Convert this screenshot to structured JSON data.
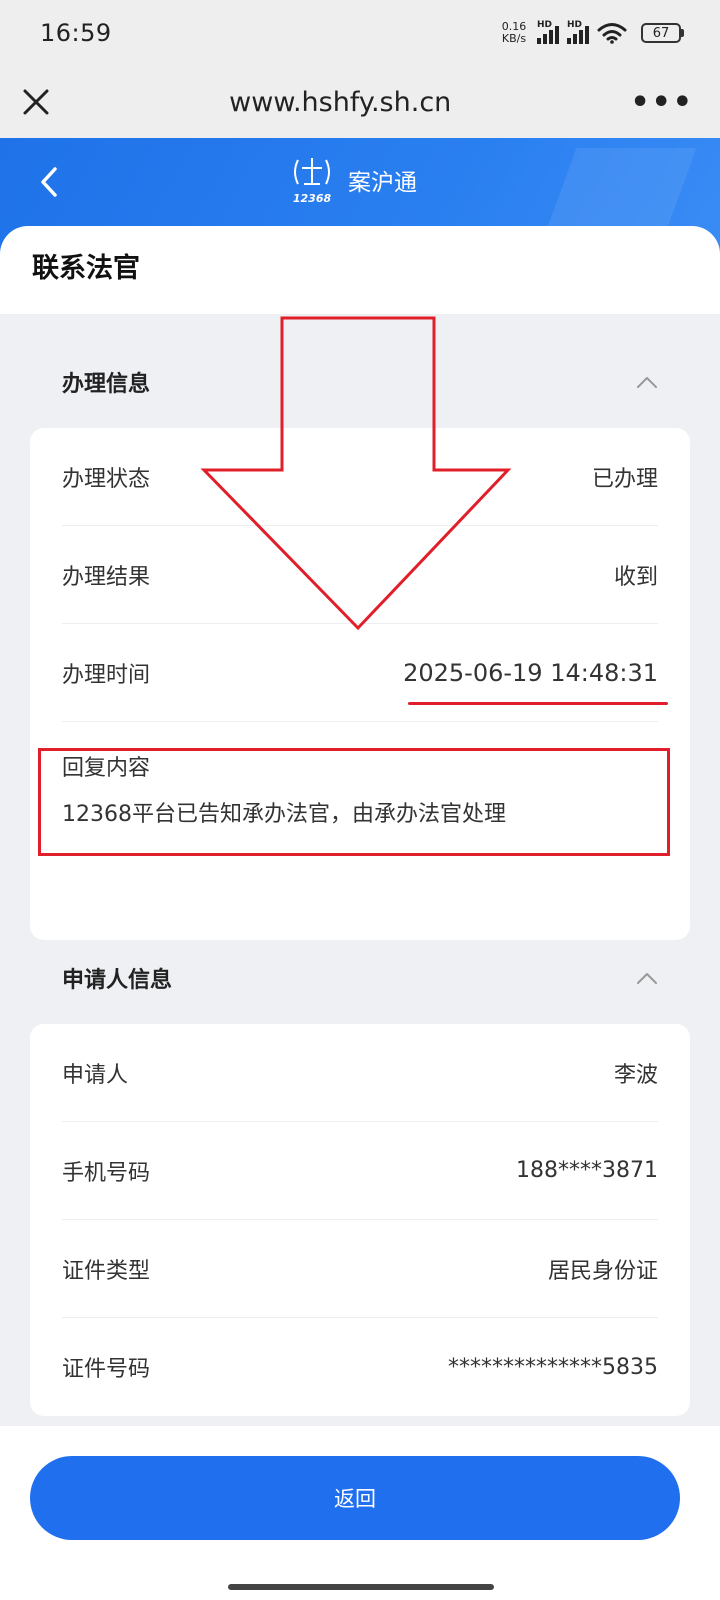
{
  "status_bar": {
    "time": "16:59",
    "net_speed_value": "0.16",
    "net_speed_unit": "KB/s",
    "signal1_label": "HD",
    "signal2_label": "HD",
    "battery": "67"
  },
  "browser": {
    "url": "www.hshfy.sh.cn",
    "more_label": "•••"
  },
  "app_header": {
    "title": "案沪通",
    "logo_text": "12368",
    "accent_color": "#1f72e8"
  },
  "page": {
    "title": "联系法官"
  },
  "handling_section": {
    "title": "办理信息",
    "rows": [
      {
        "label": "办理状态",
        "value": "已办理"
      },
      {
        "label": "办理结果",
        "value": "收到"
      },
      {
        "label": "办理时间",
        "value": "2025-06-19 14:48:31"
      }
    ],
    "reply_label": "回复内容",
    "reply_text": "12368平台已告知承办法官，由承办法官处理"
  },
  "applicant_section": {
    "title": "申请人信息",
    "rows": [
      {
        "label": "申请人",
        "value": "李波"
      },
      {
        "label": "手机号码",
        "value": "188****3871"
      },
      {
        "label": "证件类型",
        "value": "居民身份证"
      },
      {
        "label": "证件号码",
        "value": "**************5835"
      }
    ]
  },
  "footer": {
    "return_label": "返回"
  },
  "annotation_color": "#e01f2a"
}
